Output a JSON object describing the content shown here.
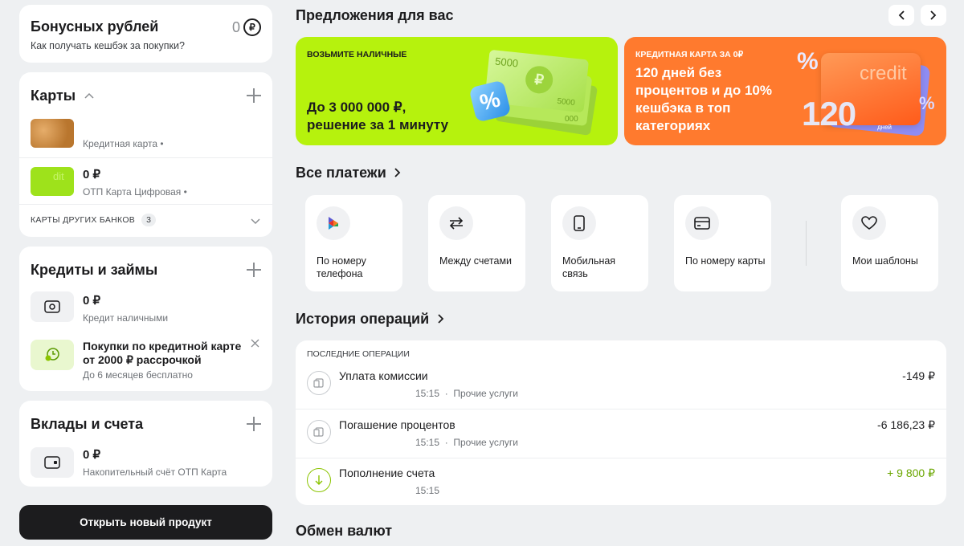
{
  "bonus": {
    "title": "Бонусных рублей",
    "link": "Как получать кешбэк за покупки?",
    "value": "0",
    "currency_symbol": "₽"
  },
  "cards": {
    "title": "Карты",
    "items": [
      {
        "amount": "",
        "name": "Кредитная карта •",
        "thumb_color": "#c9863d"
      },
      {
        "amount": "0 ₽",
        "name": "ОТП Карта Цифровая •",
        "thumb_color": "#9ee21b",
        "thumb_text": "dit"
      }
    ],
    "other_banks_label": "КАРТЫ ДРУГИХ БАНКОВ",
    "other_banks_count": "3"
  },
  "credits": {
    "title": "Кредиты и займы",
    "items": [
      {
        "amount": "0 ₽",
        "name": "Кредит наличными",
        "icon": "cash-icon"
      }
    ],
    "promo": {
      "title": "Покупки по кредитной карте от 2000 ₽ рассрочкой",
      "sub": "До 6 месяцев бесплатно",
      "icon": "clock-coin-icon"
    }
  },
  "deposits": {
    "title": "Вклады и счета",
    "items": [
      {
        "amount": "0 ₽",
        "name": "Накопительный счёт ОТП Карта",
        "icon": "wallet-icon"
      }
    ]
  },
  "open_product_button": "Открыть новый продукт",
  "offers": {
    "title": "Предложения для вас",
    "banners": [
      {
        "tag": "ВОЗЬМИТЕ НАЛИЧНЫЕ",
        "text": "До 3 000 000 ₽, решение за 1 минуту",
        "bg": "#b6f20d",
        "art_numbers": [
          "5000",
          "5000",
          "000"
        ]
      },
      {
        "tag": "КРЕДИТНАЯ КАРТА ЗА 0₽",
        "text": "120 дней без процентов и до 10% кешбэка в топ категориях",
        "bg": "#ff7a2e",
        "art_word": "credit",
        "art_number": "120",
        "art_unit": "дней"
      }
    ]
  },
  "payments": {
    "title": "Все платежи",
    "tiles": [
      {
        "label": "По номеру телефона",
        "icon": "sbp-icon"
      },
      {
        "label": "Между счетами",
        "icon": "transfer-arrows-icon"
      },
      {
        "label": "Мобильная связь",
        "icon": "phone-icon"
      },
      {
        "label": "По номеру карты",
        "icon": "card-icon"
      },
      {
        "label": "Мои шаблоны",
        "icon": "heart-icon"
      }
    ]
  },
  "history": {
    "title": "История операций",
    "caption": "ПОСЛЕДНИЕ ОПЕРАЦИИ",
    "ops": [
      {
        "name": "Уплата комиссии",
        "time": "15:15",
        "category": "Прочие услуги",
        "amount": "-149 ₽",
        "positive": false
      },
      {
        "name": "Погашение процентов",
        "time": "15:15",
        "category": "Прочие услуги",
        "amount": "-6 186,23 ₽",
        "positive": false
      },
      {
        "name": "Пополнение счета",
        "time": "15:15",
        "category": "",
        "amount": "+ 9 800 ₽",
        "positive": true
      }
    ]
  },
  "exchange": {
    "title": "Обмен валют"
  },
  "colors": {
    "accent_green": "#8bc400",
    "dark_button": "#1c1c1e",
    "positive_amount": "#6aa600"
  }
}
